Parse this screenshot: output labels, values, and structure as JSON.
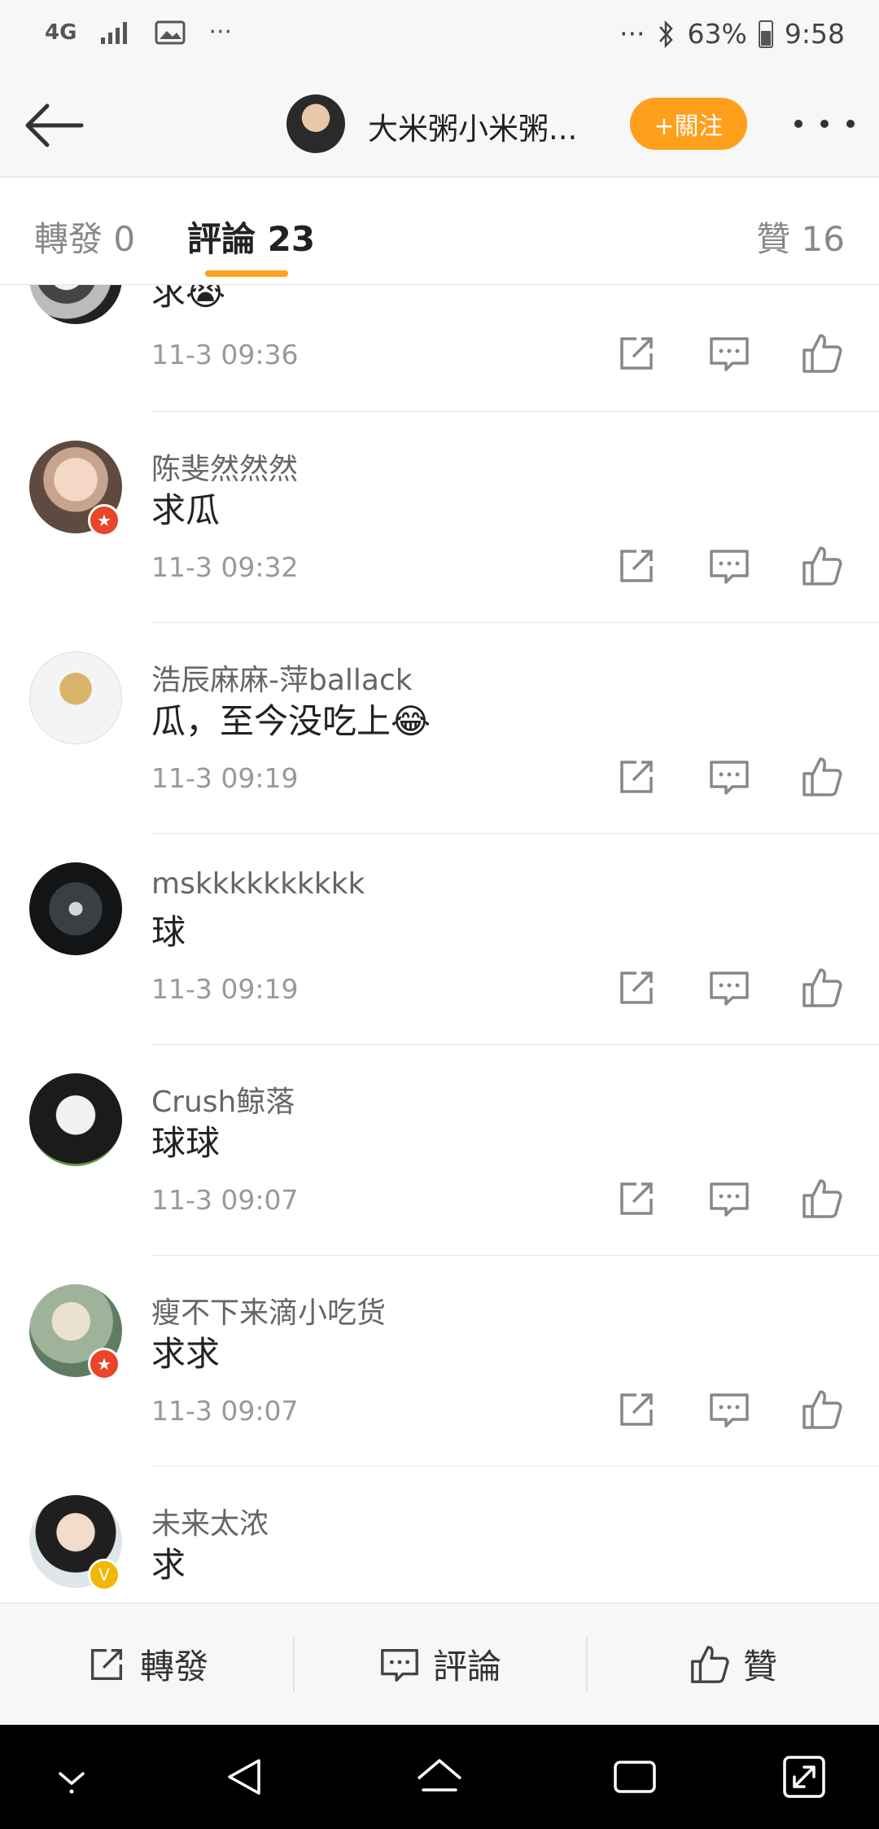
{
  "status_bar": {
    "network": "4G",
    "more": "···",
    "right_more": "···",
    "battery": "63%",
    "time": "9:58"
  },
  "header": {
    "name": "大米粥小米粥...",
    "follow_label": "+關注"
  },
  "tabs": {
    "repost": "轉發 0",
    "comments": "評論 23",
    "likes": "贊 16"
  },
  "comments": [
    {
      "user": "",
      "text": "求😭",
      "time": "11-3 09:36",
      "vip": ""
    },
    {
      "user": "陈斐然然然",
      "text": "求瓜",
      "time": "11-3 09:32",
      "vip": "red"
    },
    {
      "user": "浩辰麻麻-萍ballack",
      "text": "瓜，至今没吃上😂",
      "time": "11-3 09:19",
      "vip": ""
    },
    {
      "user": "mskkkkkkkkkk",
      "text": "球",
      "time": "11-3 09:19",
      "vip": ""
    },
    {
      "user": "Crush鲸落",
      "text": "球球",
      "time": "11-3 09:07",
      "vip": ""
    },
    {
      "user": "瘦不下来滴小吃货",
      "text": "求求",
      "time": "11-3 09:07",
      "vip": "red"
    },
    {
      "user": "未来太浓",
      "text": "求",
      "time": "",
      "vip": "gold"
    }
  ],
  "bottom_bar": {
    "repost": "轉發",
    "comment": "評論",
    "like": "贊"
  },
  "colors": {
    "accent": "#ff9f1c",
    "vip_red": "#e8452b",
    "vip_gold": "#f2b705"
  }
}
